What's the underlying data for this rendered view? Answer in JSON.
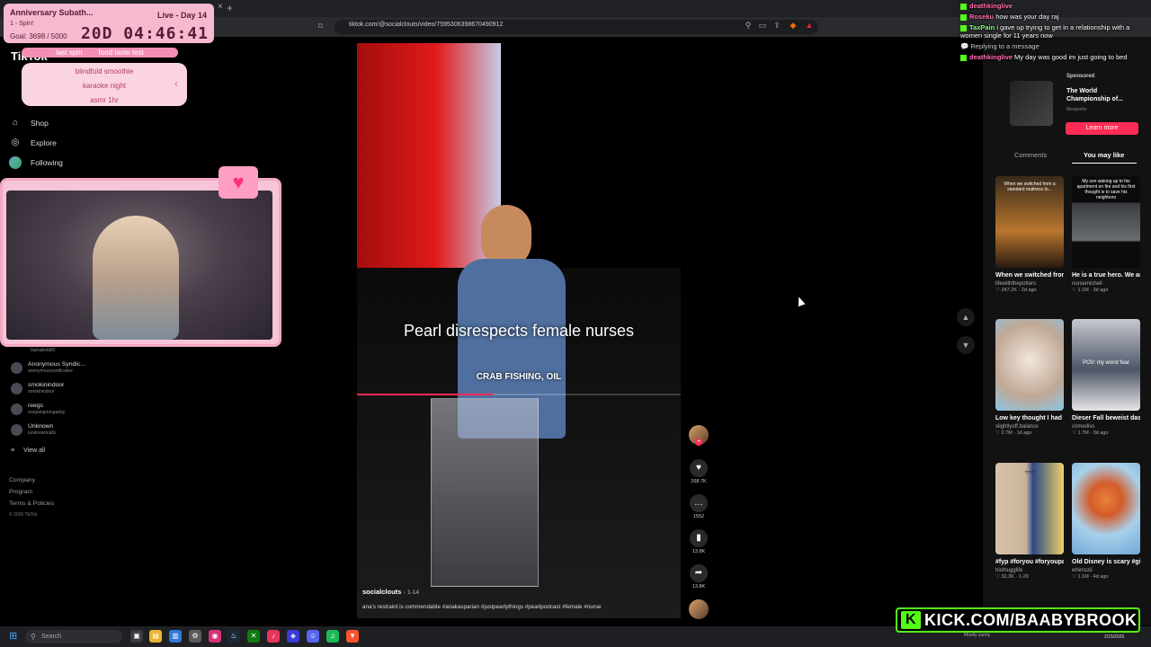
{
  "browser": {
    "url": "tiktok.com/@socialclouts/video/7595306398670490912"
  },
  "overlay": {
    "anniversary_title": "Anniversary Subath...",
    "live_day": "Live - Day 14",
    "spin_text": "1 - Spin!",
    "goal_text": "Goal: 3698 / 5000",
    "timer": "20D 04:46:41",
    "last_spin_label": "last spin",
    "last_spin_value": "food taste test",
    "wheel_items": [
      "blindfold smoothie",
      "karaoke night",
      "asmr 1hr"
    ],
    "kick_url": "KICK.COM/BAABYBROOK",
    "kick_logo": "K"
  },
  "sidebar": {
    "logo": "TikTok",
    "nav": [
      {
        "label": "Shop",
        "icon": "shop-icon"
      },
      {
        "label": "Explore",
        "icon": "compass-icon"
      },
      {
        "label": "Following",
        "icon": "following-icon"
      }
    ],
    "following": [
      {
        "name": "bamabobi82",
        "handle": ""
      },
      {
        "name": "Anonymous Syndic...",
        "handle": "anonymoussyndicatee"
      },
      {
        "name": "smokinindoor",
        "handle": "smokinindoor"
      },
      {
        "name": "reegs",
        "handle": "reegaingoongaday"
      },
      {
        "name": "Unknown",
        "handle": "iunknowncallx"
      }
    ],
    "view_all": "View all",
    "footer": [
      "Company",
      "Program",
      "Terms & Policies"
    ],
    "copyright": "© 2026 TikTok"
  },
  "video": {
    "caption_main": "Pearl disrespects female nurses",
    "caption_sub": "CRAB FISHING, OIL",
    "author": "socialclouts",
    "date": "1-14",
    "description": "ana's restraint is commendable #anakasparian #justpearlythings #pearlpodcast #female #nurse",
    "progress": 0.42,
    "likes": "268.7K",
    "comments": "1552",
    "saves": "13.8K",
    "shares": "13.8K"
  },
  "chat": [
    {
      "user": "deathkinglive",
      "msg": ""
    },
    {
      "user": "Roseku",
      "msg": "how was your day raj"
    },
    {
      "user": "TaxPain",
      "msg": "i gave up trying to get in a relationship with a women single for 11 years now"
    },
    {
      "user": "",
      "msg": "Replying to a message"
    },
    {
      "user": "deathkinglive",
      "msg": "My day was good im just going to bed"
    }
  ],
  "right_panel": {
    "sponsored_label": "Sponsored",
    "sponsored_title": "The World Championship of...",
    "sponsored_sub": "l6esports",
    "learn_more": "Learn more",
    "tabs": [
      "Comments",
      "You may like"
    ],
    "recommendations": [
      {
        "title": "When we switched from a standard...",
        "author": "lifewiththepotters",
        "likes": "247.2K",
        "age": "2d ago",
        "thumb_text": "When we switched from a standard mattress to..."
      },
      {
        "title": "He is a true hero. We are so thankf...",
        "author": "nursemichell",
        "likes": "1.1M",
        "age": "3d ago",
        "thumb_text": "My son waking up to his apartment on fire and his first thought is to save his neighbors"
      },
      {
        "title": "Low key thought I had two hands fo...",
        "author": "slightlyoff.balance",
        "likes": "2.7M",
        "age": "1d ago",
        "thumb_text": ""
      },
      {
        "title": "Dieser Fall beweist dass der Schein...",
        "author": "crimedivs",
        "likes": "1.7M",
        "age": "3d ago",
        "thumb_text": "POV: my worst fear"
      },
      {
        "title": "#fyp #foryou #foryoupage...",
        "author": "histhugglife",
        "likes": "32.3K",
        "age": "1-29",
        "thumb_text": "????"
      },
      {
        "title": "Old Disney is scary #gifedit...",
        "author": "whimszii",
        "likes": "1.1M",
        "age": "4d ago",
        "thumb_text": ""
      }
    ]
  },
  "taskbar": {
    "search_placeholder": "Search",
    "weather": "Mostly sunny",
    "date": "2/15/2026"
  }
}
